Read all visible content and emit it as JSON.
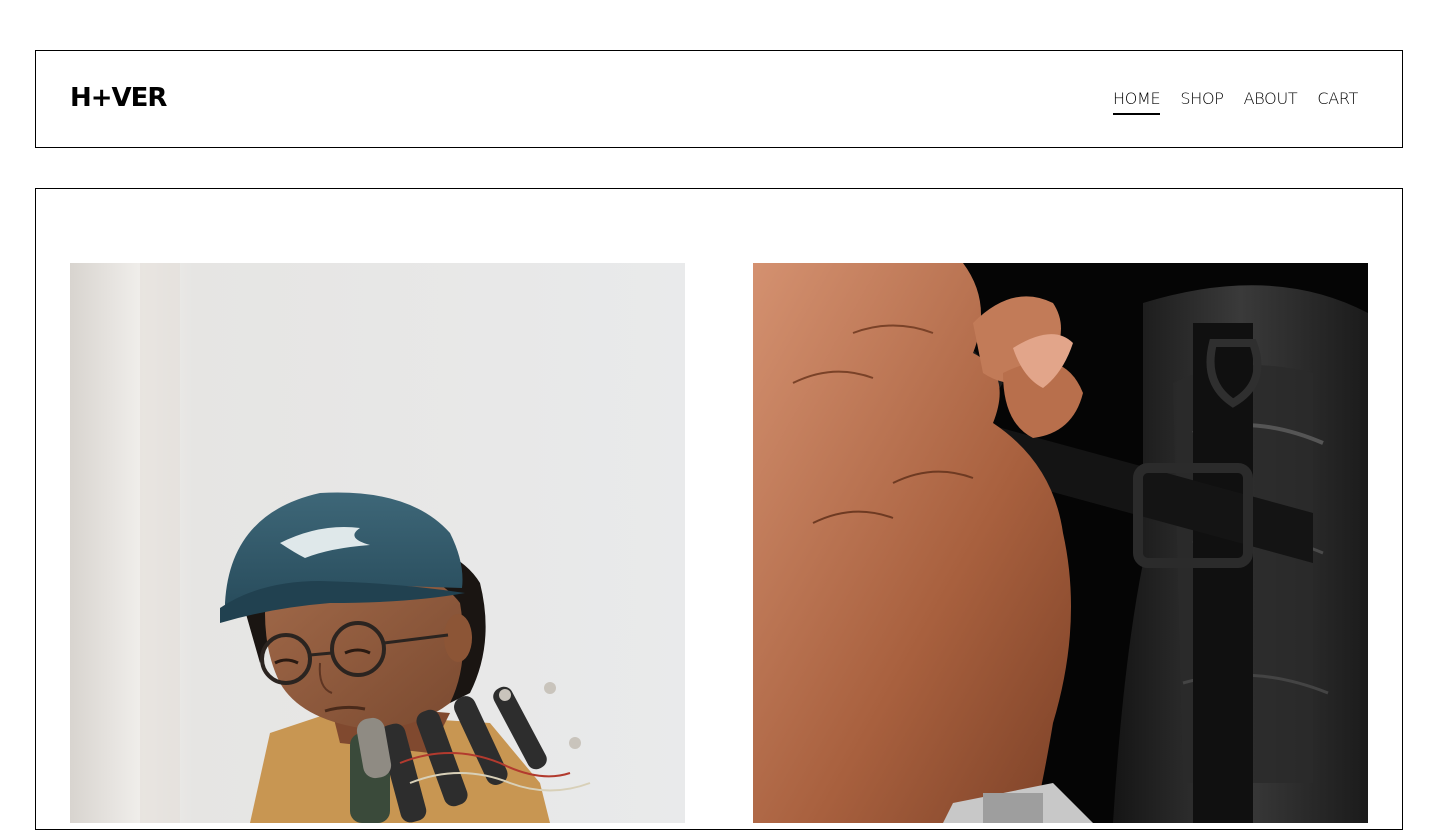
{
  "header": {
    "logo": "H+VER"
  },
  "nav": {
    "items": [
      {
        "label": "HOME",
        "active": true
      },
      {
        "label": "SHOP",
        "active": false
      },
      {
        "label": "ABOUT",
        "active": false
      },
      {
        "label": "CART",
        "active": false
      }
    ]
  },
  "gallery": {
    "images": [
      {
        "icon": "person-with-robotic-hand-photo"
      },
      {
        "icon": "hand-on-backpack-strap-photo"
      }
    ]
  },
  "colors": {
    "border": "#000000",
    "background": "#ffffff"
  }
}
